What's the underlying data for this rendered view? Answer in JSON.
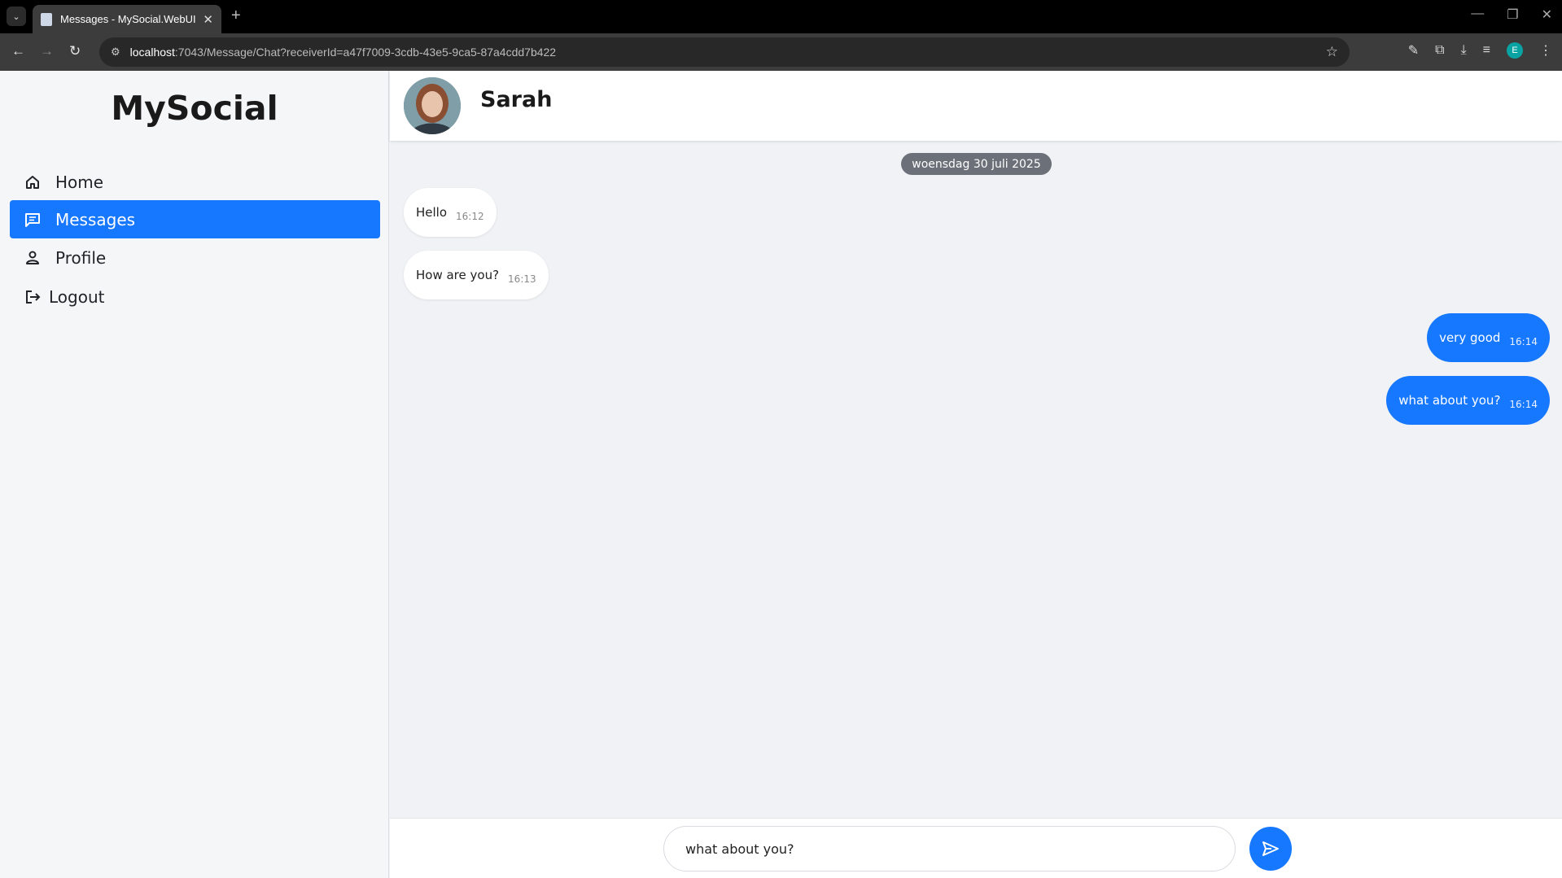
{
  "browser": {
    "tab_title": "Messages - MySocial.WebUI",
    "url_host": "localhost",
    "url_rest": ":7043/Message/Chat?receiverId=a47f7009-3cdb-43e5-9ca5-87a4cdd7b422",
    "profile_initial": "E"
  },
  "sidebar": {
    "brand": "MySocial",
    "items": [
      {
        "label": "Home",
        "icon": "home-icon"
      },
      {
        "label": "Messages",
        "icon": "messages-icon",
        "active": true
      },
      {
        "label": "Profile",
        "icon": "person-icon"
      },
      {
        "label": "Logout",
        "icon": "logout-icon"
      }
    ]
  },
  "chat": {
    "contact_name": "Sarah",
    "date_label": "woensdag 30 juli 2025",
    "messages": [
      {
        "text": "Hello",
        "time": "16:12",
        "direction": "in"
      },
      {
        "text": "How are you?",
        "time": "16:13",
        "direction": "in"
      },
      {
        "text": "very good",
        "time": "16:14",
        "direction": "out"
      },
      {
        "text": "what about you?",
        "time": "16:14",
        "direction": "out"
      }
    ],
    "input_value": "what about you?"
  },
  "colors": {
    "accent": "#1677ff",
    "date_pill": "#6b7079",
    "chat_bg": "#f0f2f5"
  }
}
